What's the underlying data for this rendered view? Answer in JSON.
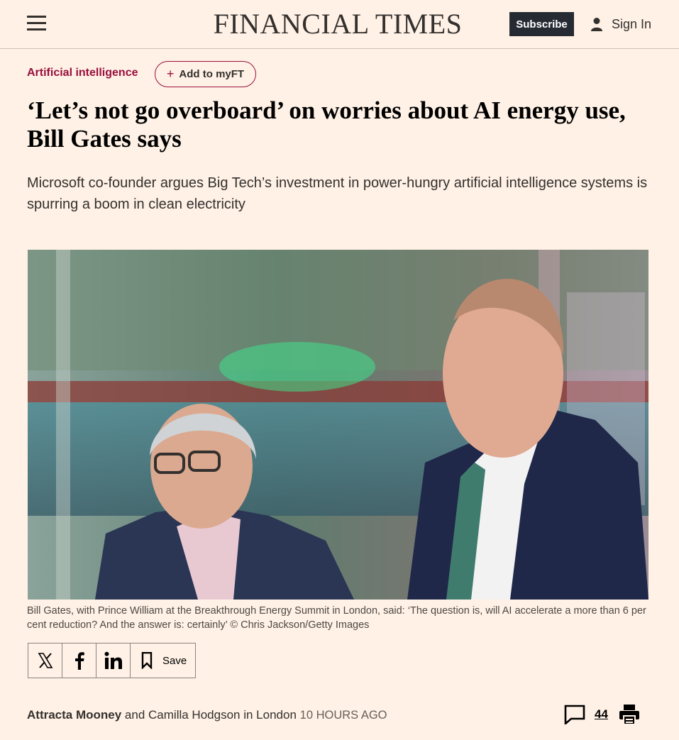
{
  "header": {
    "masthead": "FINANCIAL TIMES",
    "subscribe_label": "Subscribe",
    "signin_label": "Sign In"
  },
  "article": {
    "topic": "Artificial intelligence",
    "myft_label": "Add to myFT",
    "headline": "‘Let’s not go overboard’ on worries about AI energy use, Bill Gates says",
    "standfirst": "Microsoft co-founder argues Big Tech’s investment in power-hungry artificial intelligence systems is spurring a boom in clean electricity",
    "caption": "Bill Gates, with Prince William at the Breakthrough Energy Summit in London, said: ‘The question is, will AI accelerate a more than 6 per cent reduction? And the answer is: certainly’ © Chris Jackson/Getty Images",
    "share": {
      "icons": [
        "x-icon",
        "facebook-icon",
        "linkedin-icon",
        "bookmark-icon"
      ],
      "save_label": "Save"
    },
    "byline": {
      "author1": "Attracta Mooney",
      "conj": "and",
      "author2": "Camilla Hodgson",
      "location": "in London",
      "time": "10 hours ago"
    },
    "comment_count": "44"
  },
  "colors": {
    "background": "#fff1e5",
    "brand_claret": "#990f3d",
    "subscribe_bg": "#262a33"
  }
}
